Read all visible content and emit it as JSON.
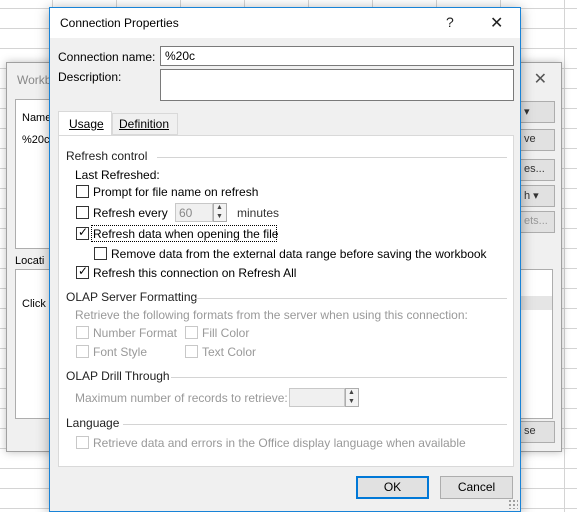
{
  "background_dialog": {
    "title": "Workb",
    "close_glyph": "✕",
    "list_header": "Name",
    "list_row": "%20c",
    "location_label": "Locati",
    "click_text": "Click",
    "right_buttons": [
      "▾",
      "ve",
      "es...",
      "h ▾",
      "ets...",
      "se"
    ]
  },
  "dialog": {
    "title": "Connection Properties",
    "help_glyph": "?",
    "close_glyph": "✕",
    "connection_name_label": "Connection name:",
    "connection_name_value": "%20c",
    "description_label": "Description:",
    "description_value": "",
    "tabs": [
      "Usage",
      "Definition"
    ],
    "refresh_control": {
      "heading": "Refresh control",
      "last_refreshed_label": "Last Refreshed:",
      "prompt_file_name": {
        "label": "Prompt for file name on refresh",
        "checked": false
      },
      "refresh_every": {
        "label": "Refresh every",
        "value": "60",
        "unit": "minutes",
        "checked": false
      },
      "refresh_on_open": {
        "label": "Refresh data when opening the file",
        "checked": true
      },
      "remove_data": {
        "label": "Remove data from the external data range before saving the workbook",
        "checked": false
      },
      "refresh_on_refresh_all": {
        "label": "Refresh this connection on Refresh All",
        "checked": true
      }
    },
    "olap_formatting": {
      "heading": "OLAP Server Formatting",
      "description": "Retrieve the following formats from the server when using this connection:",
      "number_format": "Number Format",
      "fill_color": "Fill Color",
      "font_style": "Font Style",
      "text_color": "Text Color"
    },
    "olap_drill": {
      "heading": "OLAP Drill Through",
      "max_records_label": "Maximum number of records to retrieve:",
      "max_records_value": ""
    },
    "language": {
      "heading": "Language",
      "option_label": "Retrieve data and errors in the Office display language when available"
    },
    "ok_label": "OK",
    "cancel_label": "Cancel"
  }
}
